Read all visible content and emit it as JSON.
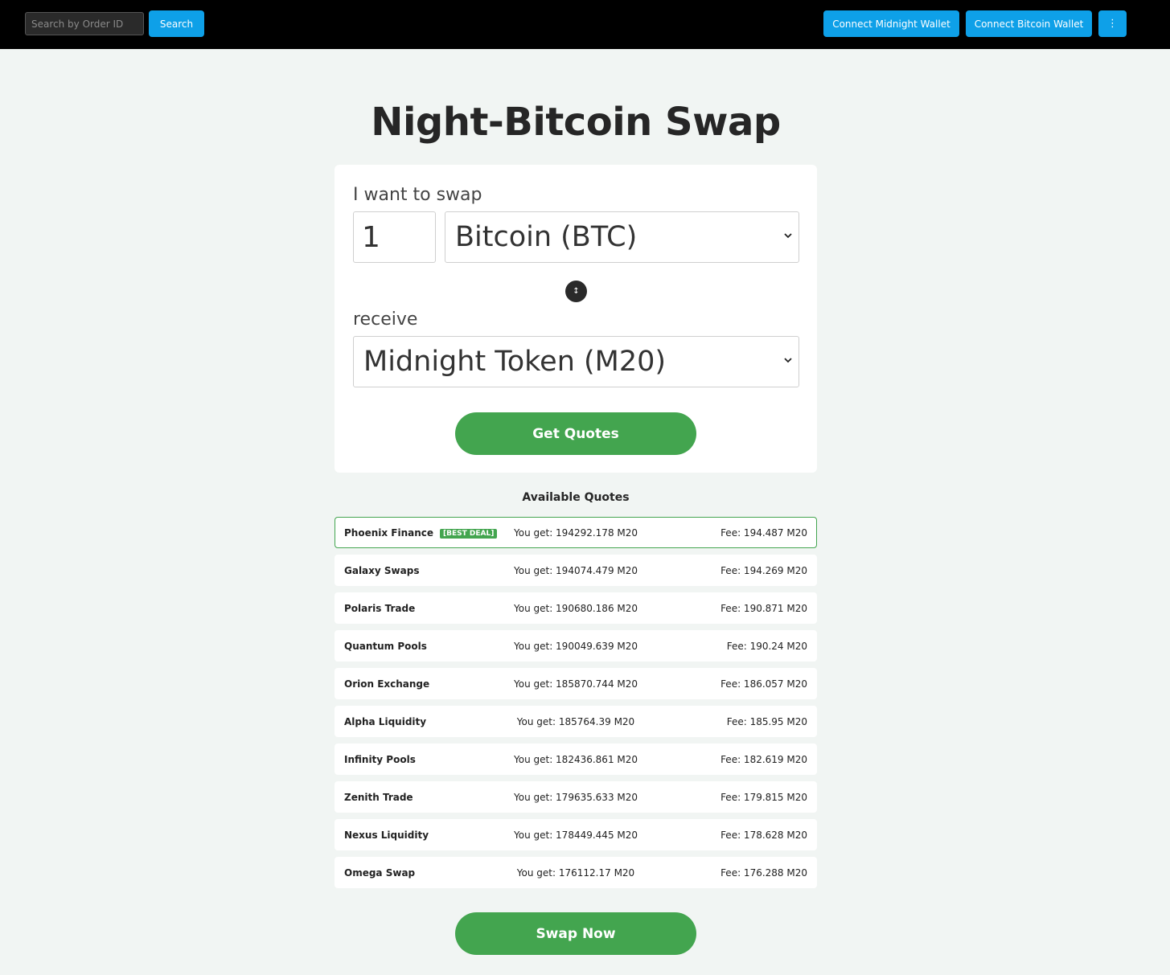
{
  "header": {
    "search_placeholder": "Search by Order ID",
    "search_label": "Search",
    "connect_midnight_label": "Connect Midnight Wallet",
    "connect_bitcoin_label": "Connect Bitcoin Wallet",
    "more_label": "⋮"
  },
  "page": {
    "title": "Night-Bitcoin Swap"
  },
  "swap": {
    "want_label": "I want to swap",
    "amount": "1",
    "from_asset": "Bitcoin (BTC)",
    "direction_icon": "↕",
    "receive_label": "receive",
    "to_asset": "Midnight Token (M20)",
    "get_quotes_label": "Get Quotes"
  },
  "quotes": {
    "heading": "Available Quotes",
    "best_badge": "[BEST DEAL]",
    "items": [
      {
        "name": "Phoenix Finance",
        "get": "You get: 194292.178 M20",
        "fee": "Fee: 194.487 M20"
      },
      {
        "name": "Galaxy Swaps",
        "get": "You get: 194074.479 M20",
        "fee": "Fee: 194.269 M20"
      },
      {
        "name": "Polaris Trade",
        "get": "You get: 190680.186 M20",
        "fee": "Fee: 190.871 M20"
      },
      {
        "name": "Quantum Pools",
        "get": "You get: 190049.639 M20",
        "fee": "Fee: 190.24 M20"
      },
      {
        "name": "Orion Exchange",
        "get": "You get: 185870.744 M20",
        "fee": "Fee: 186.057 M20"
      },
      {
        "name": "Alpha Liquidity",
        "get": "You get: 185764.39 M20",
        "fee": "Fee: 185.95 M20"
      },
      {
        "name": "Infinity Pools",
        "get": "You get: 182436.861 M20",
        "fee": "Fee: 182.619 M20"
      },
      {
        "name": "Zenith Trade",
        "get": "You get: 179635.633 M20",
        "fee": "Fee: 179.815 M20"
      },
      {
        "name": "Nexus Liquidity",
        "get": "You get: 178449.445 M20",
        "fee": "Fee: 178.628 M20"
      },
      {
        "name": "Omega Swap",
        "get": "You get: 176112.17 M20",
        "fee": "Fee: 176.288 M20"
      }
    ],
    "swap_now_label": "Swap Now"
  },
  "colors": {
    "topbar": "#000000",
    "primary_blue": "#0ea0e8",
    "accent_green": "#43a54f",
    "background": "#f1f5f3"
  }
}
